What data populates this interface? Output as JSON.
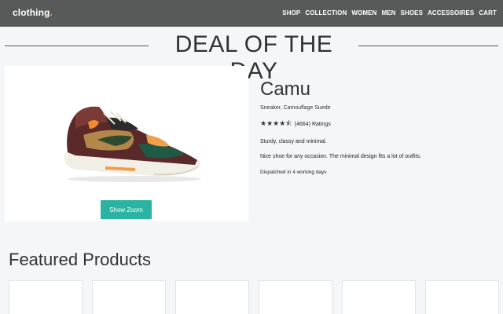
{
  "navbar": {
    "brand": "clothing",
    "brand_dot": ".",
    "links": [
      "SHOP",
      "COLLECTION",
      "WOMEN",
      "MEN",
      "SHOES",
      "ACCESSOIRES",
      "CART"
    ]
  },
  "deal": {
    "title": "DEAL OF THE DAY",
    "zoom_label": "Show Zoom"
  },
  "product": {
    "name": "Camu",
    "subtitle": "Sneaker, Camouflage Suede",
    "rating_stars": 4.5,
    "rating_text": "(4664) Ratings",
    "desc1": "Sturdy, classy and minimal.",
    "desc2": "Nice shoe for any occasion. The minimal design fits a lot of outfits.",
    "dispatch": "Dispatched in 4 working days"
  },
  "featured": {
    "title": "Featured Products",
    "cards": [
      {
        "accent": "#b5654a"
      },
      {
        "accent": "#4a5563"
      },
      {
        "accent": "#e1a08a"
      },
      {
        "accent": "#7a7a7a"
      },
      {
        "accent": "#3a8fd0"
      },
      {
        "accent": "#9aa0a6"
      }
    ]
  },
  "colors": {
    "navbar": "#585a59",
    "accent": "#2bb3a2",
    "background": "#f4f6f8"
  }
}
